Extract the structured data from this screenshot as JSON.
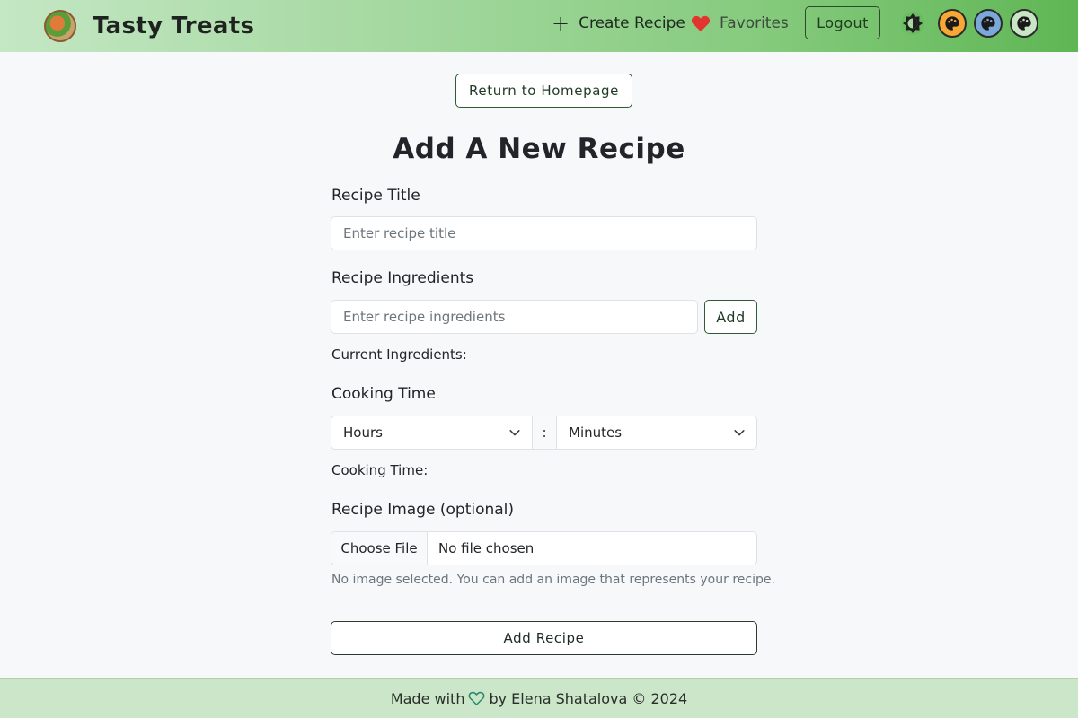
{
  "navbar": {
    "brand": "Tasty Treats",
    "create_label": "Create Recipe",
    "favorites_label": "Favorites",
    "logout_label": "Logout",
    "gradient_start": "#c4e7c4",
    "gradient_end": "#5fb654"
  },
  "theme_buttons": [
    {
      "name": "brightness-icon"
    },
    {
      "name": "palette-icon",
      "color": "#f6a736"
    },
    {
      "name": "palette-icon",
      "color": "#7aa8d8"
    },
    {
      "name": "palette-icon",
      "color": "#c8e6c6"
    }
  ],
  "return_label": "Return to Homepage",
  "page_title": "Add A New Recipe",
  "form": {
    "title_label": "Recipe Title",
    "title_placeholder": "Enter recipe title",
    "ingredients_label": "Recipe Ingredients",
    "ingredients_placeholder": "Enter recipe ingredients",
    "add_label": "Add",
    "current_ingredients": "Current Ingredients:",
    "cooking_time_label": "Cooking Time",
    "hours_value": "Hours",
    "separator": ":",
    "minutes_value": "Minutes",
    "cooking_time_display": "Cooking Time:",
    "image_label": "Recipe Image (optional)",
    "choose_file": "Choose File",
    "file_status": "No file chosen",
    "image_help": "No image selected. You can add an image that represents your recipe.",
    "submit_label": "Add Recipe"
  },
  "footer": {
    "made_with": "Made with",
    "by_text": "by Elena Shatalova © 2024",
    "heart_color": "#2e8b6e"
  }
}
